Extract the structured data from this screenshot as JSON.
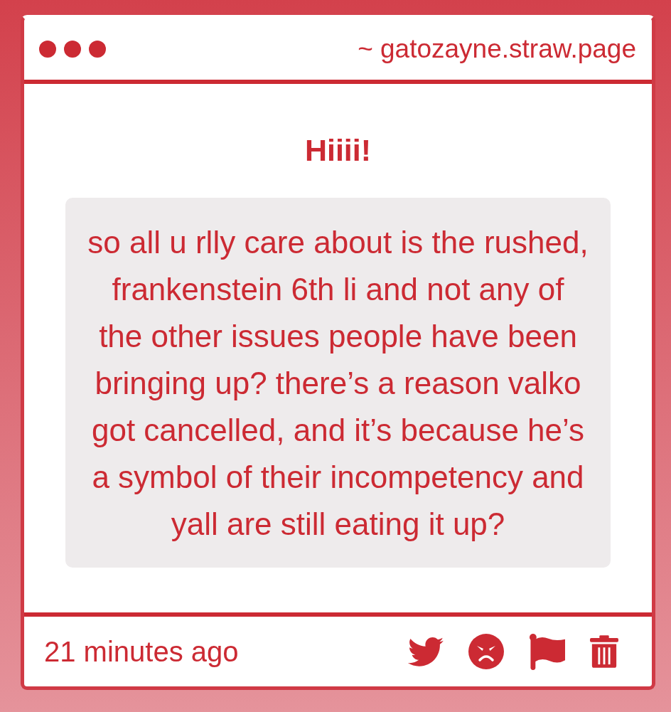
{
  "window": {
    "address": "~ gatozayne.straw.page"
  },
  "post": {
    "title": "Hiiii!",
    "message": "so all u rlly care about is the rushed, frankenstein 6th li and not any of the other issues people have been bringing up? there’s a reason valko got cancelled, and it’s because he’s a symbol of their incompetency and yall are still eating it up?"
  },
  "footer": {
    "time": "21 minutes ago"
  }
}
